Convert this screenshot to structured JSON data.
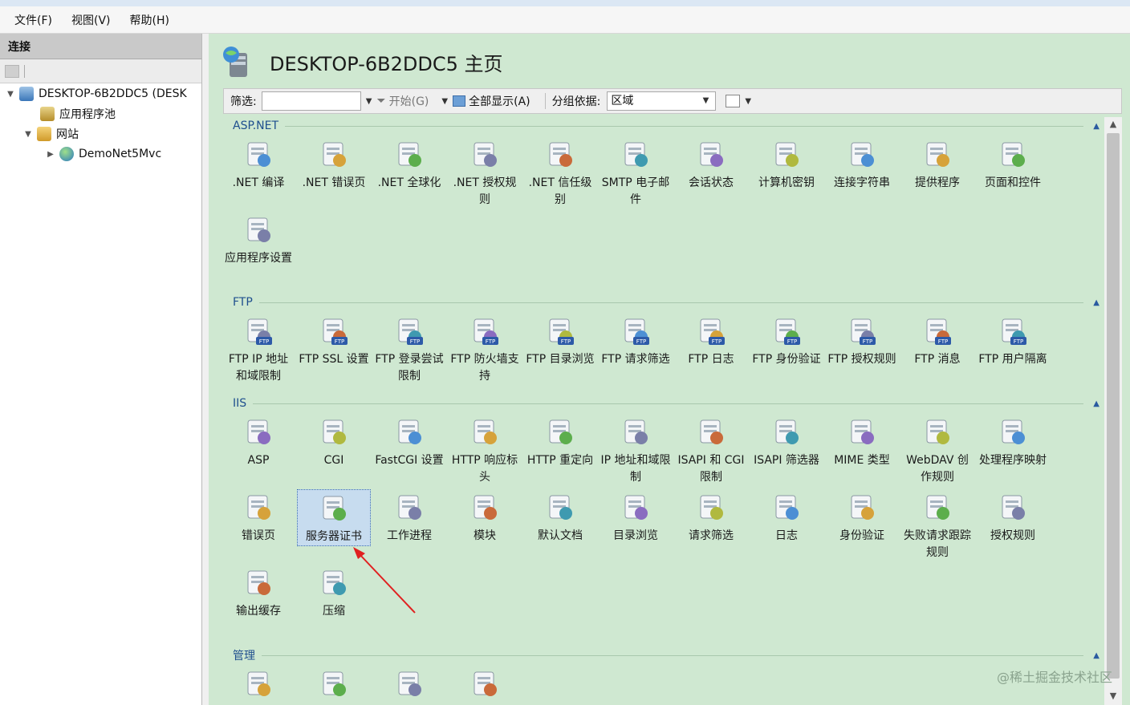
{
  "menubar": {
    "items": [
      "文件(F)",
      "视图(V)",
      "帮助(H)"
    ]
  },
  "connections": {
    "header": "连接",
    "tree": [
      {
        "label": "DESKTOP-6B2DDC5 (DESK",
        "level": 0,
        "expanded": true,
        "icon": "server-icon"
      },
      {
        "label": "应用程序池",
        "level": 1,
        "expanded": null,
        "icon": "app-pool-icon"
      },
      {
        "label": "网站",
        "level": 1,
        "expanded": true,
        "icon": "sites-folder-icon"
      },
      {
        "label": "DemoNet5Mvc",
        "level": 2,
        "expanded": false,
        "icon": "globe-icon"
      }
    ]
  },
  "main": {
    "title": "DESKTOP-6B2DDC5 主页",
    "filter": {
      "label": "筛选:",
      "value": "",
      "start": "开始(G)",
      "show_all": "全部显示(A)",
      "group_by": "分组依据:",
      "group_value": "区域"
    },
    "sections": [
      {
        "name": "ASP.NET",
        "items": [
          ".NET 编译",
          ".NET 错误页",
          ".NET 全球化",
          ".NET 授权规则",
          ".NET 信任级别",
          "SMTP 电子邮件",
          "会话状态",
          "计算机密钥",
          "连接字符串",
          "提供程序",
          "页面和控件",
          "应用程序设置"
        ]
      },
      {
        "name": "FTP",
        "items": [
          "FTP IP 地址和域限制",
          "FTP SSL 设置",
          "FTP 登录尝试限制",
          "FTP 防火墙支持",
          "FTP 目录浏览",
          "FTP 请求筛选",
          "FTP 日志",
          "FTP 身份验证",
          "FTP 授权规则",
          "FTP 消息",
          "FTP 用户隔离"
        ]
      },
      {
        "name": "IIS",
        "items": [
          "ASP",
          "CGI",
          "FastCGI 设置",
          "HTTP 响应标头",
          "HTTP 重定向",
          "IP 地址和域限制",
          "ISAPI 和 CGI 限制",
          "ISAPI 筛选器",
          "MIME 类型",
          "WebDAV 创作规则",
          "处理程序映射",
          "错误页",
          "服务器证书",
          "工作进程",
          "模块",
          "默认文档",
          "目录浏览",
          "请求筛选",
          "日志",
          "身份验证",
          "失败请求跟踪规则",
          "授权规则",
          "输出缓存",
          "压缩"
        ]
      },
      {
        "name": "管理",
        "items": [
          "",
          "",
          "",
          ""
        ]
      }
    ],
    "selected_item": "服务器证书"
  },
  "watermark": "@稀土掘金技术社区"
}
